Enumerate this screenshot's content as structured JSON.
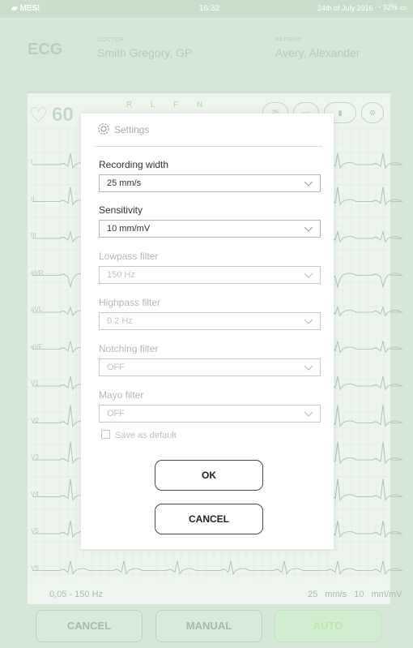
{
  "status_bar": {
    "app_name": "MESI",
    "time": "16:32",
    "date": "24th of July 2016",
    "battery": "92%"
  },
  "header": {
    "title": "ECG",
    "doctor_label": "DOCTOR",
    "doctor_name": "Smith Gregory, GP",
    "patient_label": "PATIENT",
    "patient_name": "Avery, Alexander"
  },
  "monitor": {
    "heart_rate": "60",
    "electrodes": "R L F N",
    "speed_icon": "25",
    "leads": [
      "I",
      "II",
      "III",
      "aVR",
      "aVL",
      "aVF",
      "V1",
      "V2",
      "V3",
      "V4",
      "V5",
      "V6"
    ],
    "filter_range": "0,05 - 150 Hz",
    "speed": "25 mm/s",
    "sensitivity": "10 mm/mV"
  },
  "bottom_bar": {
    "cancel_label": "CANCEL",
    "manual_label": "MANUAL",
    "auto_label": "AUTO"
  },
  "settings_dialog": {
    "title": "Settings",
    "fields": [
      {
        "label": "Recording width",
        "value": "25 mm/s",
        "enabled": true
      },
      {
        "label": "Sensitivity",
        "value": "10 mm/mV",
        "enabled": true
      },
      {
        "label": "Lowpass filter",
        "value": "150 Hz",
        "enabled": false
      },
      {
        "label": "Highpass filter",
        "value": "0.2 Hz",
        "enabled": false
      },
      {
        "label": "Notching filter",
        "value": "OFF",
        "enabled": false
      },
      {
        "label": "Mayo filter",
        "value": "OFF",
        "enabled": false
      }
    ],
    "save_default_label": "Save as default",
    "ok_label": "OK",
    "cancel_label": "CANCEL"
  },
  "colors": {
    "overlay_green": "#d5e7d7",
    "grid_green": "#dcead9",
    "trace_green": "#b3c9b4",
    "auto_green": "#bde6ab"
  }
}
